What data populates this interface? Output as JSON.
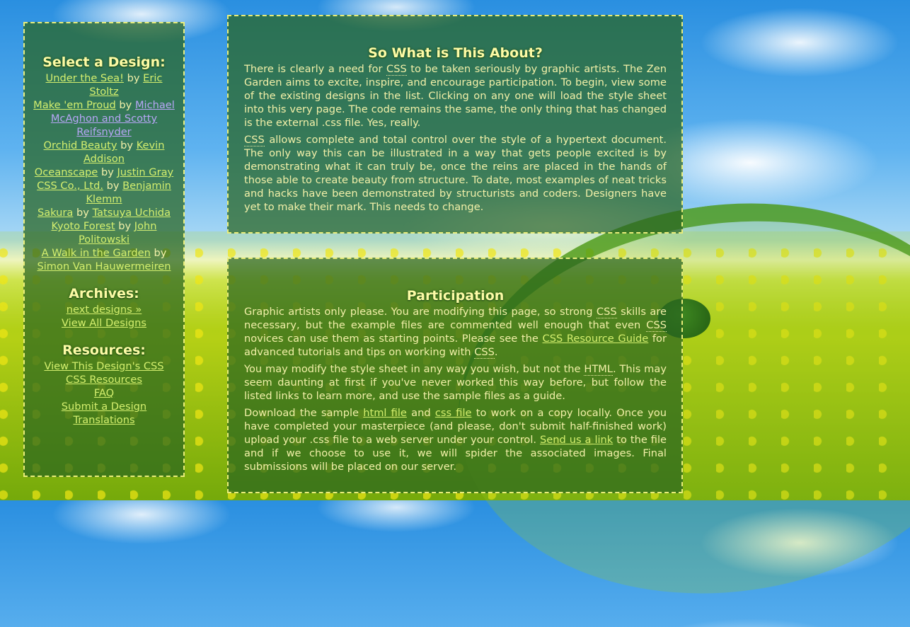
{
  "sidebar": {
    "select_heading": "Select a Design:",
    "designs": [
      {
        "name": "Under the Sea!",
        "by": "by",
        "author": "Eric Stoltz",
        "visited": false
      },
      {
        "name": "Make 'em Proud",
        "by": "by",
        "author": "Michael McAghon and Scotty Reifsnyder",
        "visited": true
      },
      {
        "name": "Orchid Beauty",
        "by": "by",
        "author": "Kevin Addison",
        "visited": false
      },
      {
        "name": "Oceanscape",
        "by": "by",
        "author": "Justin Gray",
        "visited": false
      },
      {
        "name": "CSS Co., Ltd.",
        "by": "by",
        "author": "Benjamin Klemm",
        "visited": false
      },
      {
        "name": "Sakura",
        "by": "by",
        "author": "Tatsuya Uchida",
        "visited": false
      },
      {
        "name": "Kyoto Forest",
        "by": "by",
        "author": "John Politowski",
        "visited": false
      },
      {
        "name": "A Walk in the Garden",
        "by": "by",
        "author": "Simon Van Hauwermeiren",
        "visited": false
      }
    ],
    "archives_heading": "Archives:",
    "archives": [
      "next designs »",
      "View All Designs"
    ],
    "resources_heading": "Resources:",
    "resources": [
      "View This Design's CSS",
      "CSS Resources",
      "FAQ",
      "Submit a Design",
      "Translations"
    ]
  },
  "about": {
    "heading": "So What is This About?",
    "p1": {
      "a": "There is clearly a need for ",
      "abbr": "CSS",
      "b": " to be taken seriously by graphic artists. The Zen Garden aims to excite, inspire, and encourage participation. To begin, view some of the existing designs in the list. Clicking on any one will load the style sheet into this very page. The code remains the same, the only thing that has changed is the external .css file. Yes, really."
    },
    "p2": {
      "abbr": "CSS",
      "b": " allows complete and total control over the style of a hypertext document. The only way this can be illustrated in a way that gets people excited is by demonstrating what it can truly be, once the reins are placed in the hands of those able to create beauty from structure. To date, most examples of neat tricks and hacks have been demonstrated by structurists and coders. Designers have yet to make their mark. This needs to change."
    }
  },
  "participation": {
    "heading": "Participation",
    "p1": {
      "a": "Graphic artists only please. You are modifying this page, so strong ",
      "abbr1": "CSS",
      "b": " skills are necessary, but the example files are commented well enough that even ",
      "abbr2": "CSS",
      "c": " novices can use them as starting points. Please see the ",
      "link": "CSS Resource Guide",
      "d": " for advanced tutorials and tips on working with ",
      "abbr3": "CSS",
      "e": "."
    },
    "p2": {
      "a": "You may modify the style sheet in any way you wish, but not the ",
      "abbr": "HTML",
      "b": ". This may seem daunting at first if you've never worked this way before, but follow the listed links to learn more, and use the sample files as a guide."
    },
    "p3": {
      "a": "Download the sample ",
      "link1": "html file",
      "b": " and ",
      "link2": "css file",
      "c": " to work on a copy locally. Once you have completed your masterpiece (and please, don't submit half-finished work) upload your .css file to a web server under your control. ",
      "link3": "Send us a link",
      "d": " to the file and if we choose to use it, we will spider the associated images. Final submissions will be placed on our server."
    }
  },
  "colors": {
    "panel_bg": "#28641e",
    "border": "#e8ec7a",
    "heading": "#fdfba6",
    "text": "#f2f0a8",
    "link": "#d4ef6e",
    "visited_link": "#b7a6f6"
  }
}
